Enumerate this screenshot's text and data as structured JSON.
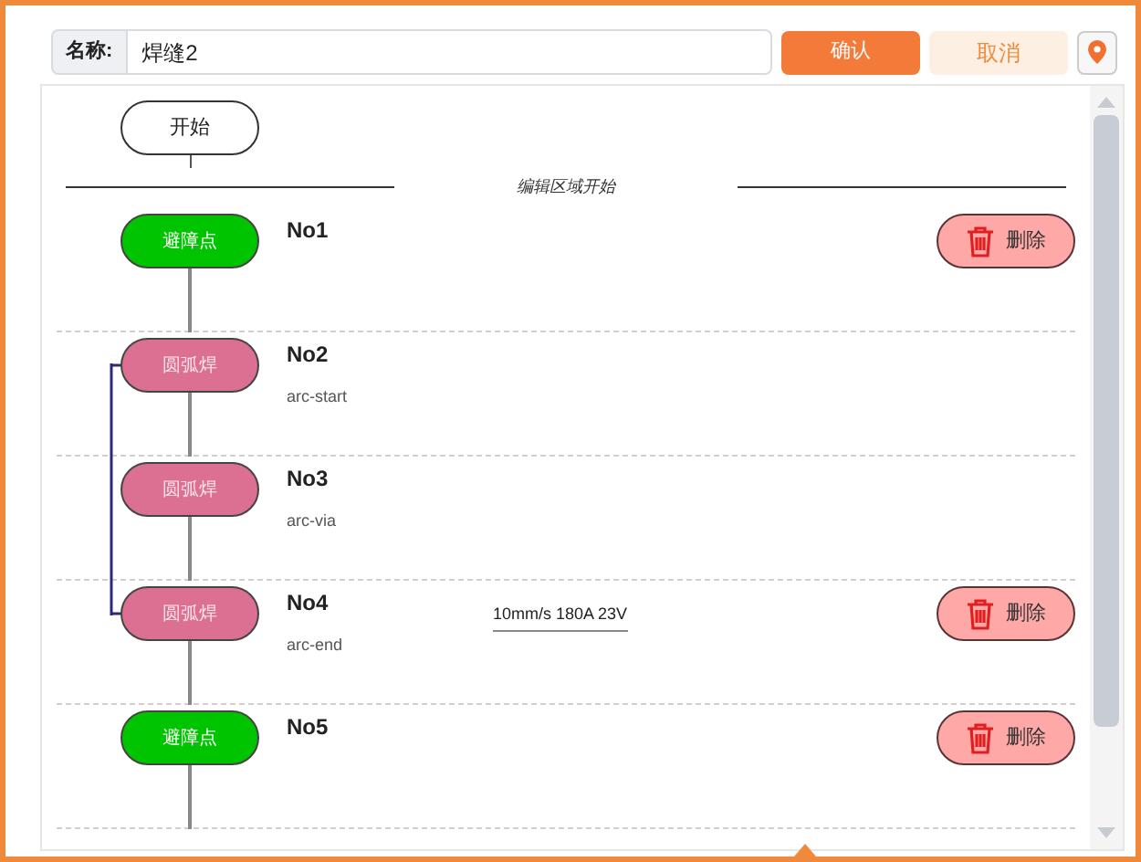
{
  "header": {
    "name_label": "名称:",
    "name_value": "焊缝2",
    "confirm": "确认",
    "cancel": "取消"
  },
  "start_node": "开始",
  "edit_start_label": "编辑区域开始",
  "steps": [
    {
      "kind": "avoid",
      "node": "避障点",
      "number": "No1",
      "bracketed": false,
      "delete_label": "删除"
    },
    {
      "kind": "arc",
      "node": "圆弧焊",
      "number": "No2",
      "sub": "arc-start",
      "bracketed": true
    },
    {
      "kind": "arc",
      "node": "圆弧焊",
      "number": "No3",
      "sub": "arc-via",
      "bracketed": true
    },
    {
      "kind": "arc",
      "node": "圆弧焊",
      "number": "No4",
      "sub": "arc-end",
      "params": "10mm/s 180A 23V",
      "bracketed": true,
      "delete_label": "删除"
    },
    {
      "kind": "avoid",
      "node": "避障点",
      "number": "No5",
      "bracketed": false,
      "delete_label": "删除"
    }
  ]
}
